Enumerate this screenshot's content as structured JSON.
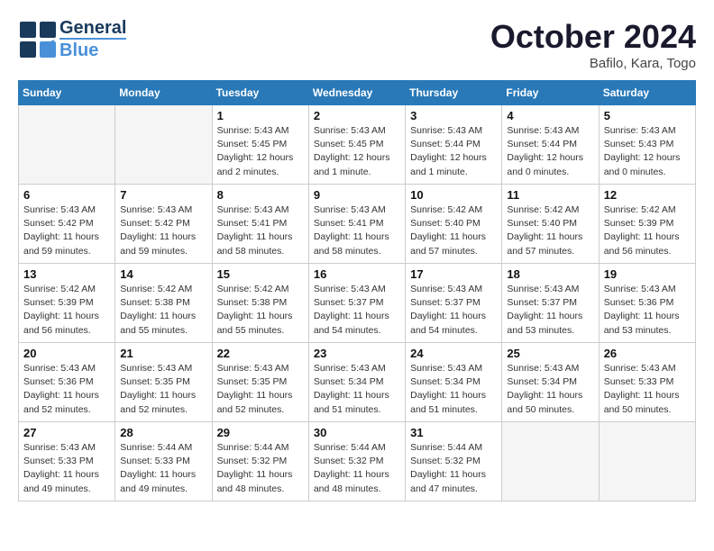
{
  "header": {
    "logo_line1": "General",
    "logo_line2": "Blue",
    "month": "October 2024",
    "location": "Bafilo, Kara, Togo"
  },
  "days_of_week": [
    "Sunday",
    "Monday",
    "Tuesday",
    "Wednesday",
    "Thursday",
    "Friday",
    "Saturday"
  ],
  "weeks": [
    [
      {
        "day": "",
        "info": ""
      },
      {
        "day": "",
        "info": ""
      },
      {
        "day": "1",
        "info": "Sunrise: 5:43 AM\nSunset: 5:45 PM\nDaylight: 12 hours\nand 2 minutes."
      },
      {
        "day": "2",
        "info": "Sunrise: 5:43 AM\nSunset: 5:45 PM\nDaylight: 12 hours\nand 1 minute."
      },
      {
        "day": "3",
        "info": "Sunrise: 5:43 AM\nSunset: 5:44 PM\nDaylight: 12 hours\nand 1 minute."
      },
      {
        "day": "4",
        "info": "Sunrise: 5:43 AM\nSunset: 5:44 PM\nDaylight: 12 hours\nand 0 minutes."
      },
      {
        "day": "5",
        "info": "Sunrise: 5:43 AM\nSunset: 5:43 PM\nDaylight: 12 hours\nand 0 minutes."
      }
    ],
    [
      {
        "day": "6",
        "info": "Sunrise: 5:43 AM\nSunset: 5:42 PM\nDaylight: 11 hours\nand 59 minutes."
      },
      {
        "day": "7",
        "info": "Sunrise: 5:43 AM\nSunset: 5:42 PM\nDaylight: 11 hours\nand 59 minutes."
      },
      {
        "day": "8",
        "info": "Sunrise: 5:43 AM\nSunset: 5:41 PM\nDaylight: 11 hours\nand 58 minutes."
      },
      {
        "day": "9",
        "info": "Sunrise: 5:43 AM\nSunset: 5:41 PM\nDaylight: 11 hours\nand 58 minutes."
      },
      {
        "day": "10",
        "info": "Sunrise: 5:42 AM\nSunset: 5:40 PM\nDaylight: 11 hours\nand 57 minutes."
      },
      {
        "day": "11",
        "info": "Sunrise: 5:42 AM\nSunset: 5:40 PM\nDaylight: 11 hours\nand 57 minutes."
      },
      {
        "day": "12",
        "info": "Sunrise: 5:42 AM\nSunset: 5:39 PM\nDaylight: 11 hours\nand 56 minutes."
      }
    ],
    [
      {
        "day": "13",
        "info": "Sunrise: 5:42 AM\nSunset: 5:39 PM\nDaylight: 11 hours\nand 56 minutes."
      },
      {
        "day": "14",
        "info": "Sunrise: 5:42 AM\nSunset: 5:38 PM\nDaylight: 11 hours\nand 55 minutes."
      },
      {
        "day": "15",
        "info": "Sunrise: 5:42 AM\nSunset: 5:38 PM\nDaylight: 11 hours\nand 55 minutes."
      },
      {
        "day": "16",
        "info": "Sunrise: 5:43 AM\nSunset: 5:37 PM\nDaylight: 11 hours\nand 54 minutes."
      },
      {
        "day": "17",
        "info": "Sunrise: 5:43 AM\nSunset: 5:37 PM\nDaylight: 11 hours\nand 54 minutes."
      },
      {
        "day": "18",
        "info": "Sunrise: 5:43 AM\nSunset: 5:37 PM\nDaylight: 11 hours\nand 53 minutes."
      },
      {
        "day": "19",
        "info": "Sunrise: 5:43 AM\nSunset: 5:36 PM\nDaylight: 11 hours\nand 53 minutes."
      }
    ],
    [
      {
        "day": "20",
        "info": "Sunrise: 5:43 AM\nSunset: 5:36 PM\nDaylight: 11 hours\nand 52 minutes."
      },
      {
        "day": "21",
        "info": "Sunrise: 5:43 AM\nSunset: 5:35 PM\nDaylight: 11 hours\nand 52 minutes."
      },
      {
        "day": "22",
        "info": "Sunrise: 5:43 AM\nSunset: 5:35 PM\nDaylight: 11 hours\nand 52 minutes."
      },
      {
        "day": "23",
        "info": "Sunrise: 5:43 AM\nSunset: 5:34 PM\nDaylight: 11 hours\nand 51 minutes."
      },
      {
        "day": "24",
        "info": "Sunrise: 5:43 AM\nSunset: 5:34 PM\nDaylight: 11 hours\nand 51 minutes."
      },
      {
        "day": "25",
        "info": "Sunrise: 5:43 AM\nSunset: 5:34 PM\nDaylight: 11 hours\nand 50 minutes."
      },
      {
        "day": "26",
        "info": "Sunrise: 5:43 AM\nSunset: 5:33 PM\nDaylight: 11 hours\nand 50 minutes."
      }
    ],
    [
      {
        "day": "27",
        "info": "Sunrise: 5:43 AM\nSunset: 5:33 PM\nDaylight: 11 hours\nand 49 minutes."
      },
      {
        "day": "28",
        "info": "Sunrise: 5:44 AM\nSunset: 5:33 PM\nDaylight: 11 hours\nand 49 minutes."
      },
      {
        "day": "29",
        "info": "Sunrise: 5:44 AM\nSunset: 5:32 PM\nDaylight: 11 hours\nand 48 minutes."
      },
      {
        "day": "30",
        "info": "Sunrise: 5:44 AM\nSunset: 5:32 PM\nDaylight: 11 hours\nand 48 minutes."
      },
      {
        "day": "31",
        "info": "Sunrise: 5:44 AM\nSunset: 5:32 PM\nDaylight: 11 hours\nand 47 minutes."
      },
      {
        "day": "",
        "info": ""
      },
      {
        "day": "",
        "info": ""
      }
    ]
  ]
}
